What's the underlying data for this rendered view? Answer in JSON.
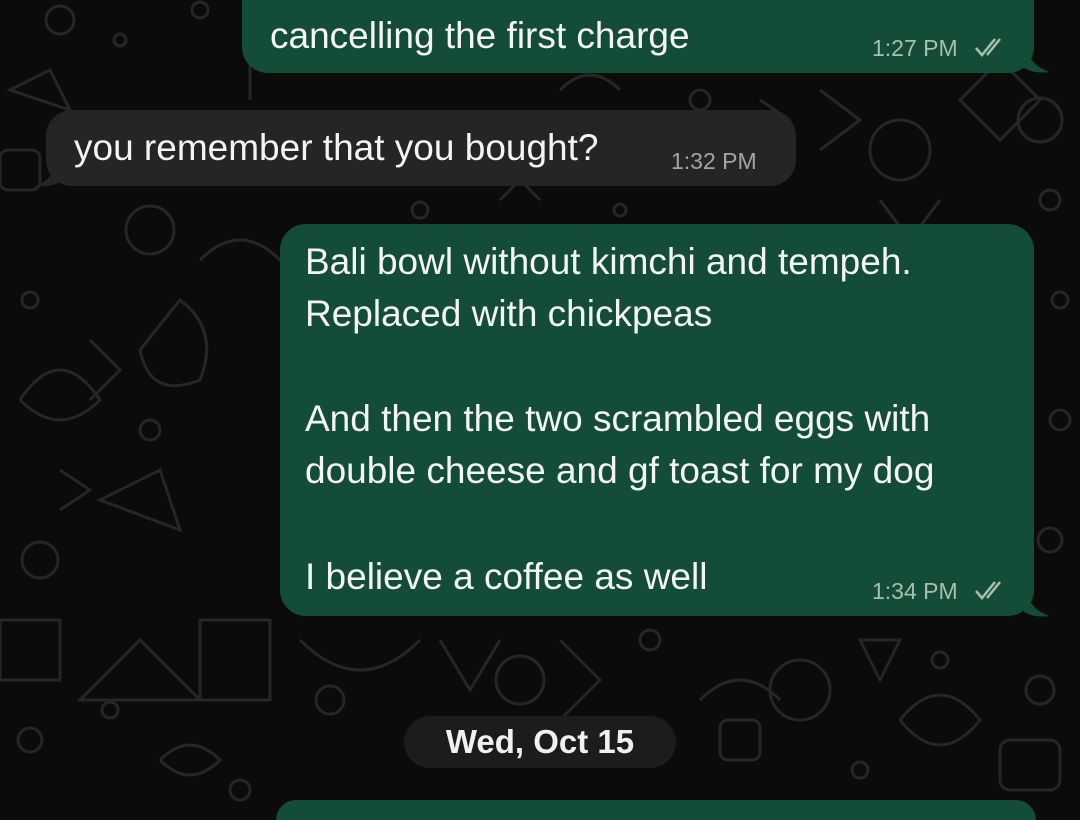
{
  "messages": [
    {
      "direction": "outgoing",
      "text": "cancelling the first charge",
      "time": "1:27 PM",
      "status_icon": "double-check-icon"
    },
    {
      "direction": "incoming",
      "text": "you remember that you bought?",
      "time": "1:32 PM"
    },
    {
      "direction": "outgoing",
      "lines": [
        "Bali bowl without kimchi and tempeh.",
        "Replaced with chickpeas",
        "",
        "And then the two scrambled eggs with",
        "double cheese and gf toast for my dog",
        "",
        "I believe a coffee as well"
      ],
      "time": "1:34 PM",
      "status_icon": "double-check-icon"
    }
  ],
  "date_separator": "Wed, Oct 15",
  "colors": {
    "background": "#0b0b0b",
    "outgoing_bubble": "#144d37",
    "incoming_bubble": "#242626"
  }
}
